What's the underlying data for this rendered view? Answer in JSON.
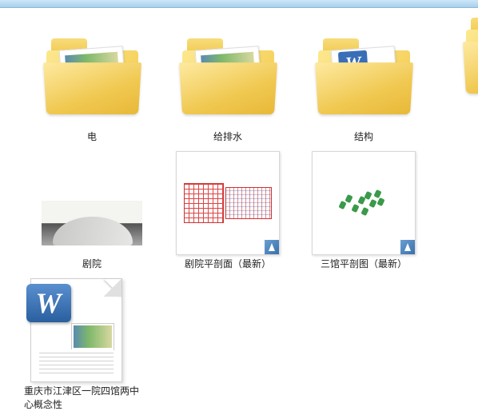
{
  "toolbar": {},
  "items": [
    {
      "label": "电",
      "type": "folder-img"
    },
    {
      "label": "给排水",
      "type": "folder-img"
    },
    {
      "label": "结构",
      "type": "folder-word"
    },
    {
      "label": "剧院",
      "type": "render"
    },
    {
      "label": "剧院平剖面（最新）",
      "type": "drawing-grid"
    },
    {
      "label": "三馆平剖图（最新）",
      "type": "drawing-dots"
    },
    {
      "label": "重庆市江津区一院四馆两中心概念性",
      "type": "worddoc"
    }
  ],
  "partial_right": {
    "type": "folder-img"
  }
}
